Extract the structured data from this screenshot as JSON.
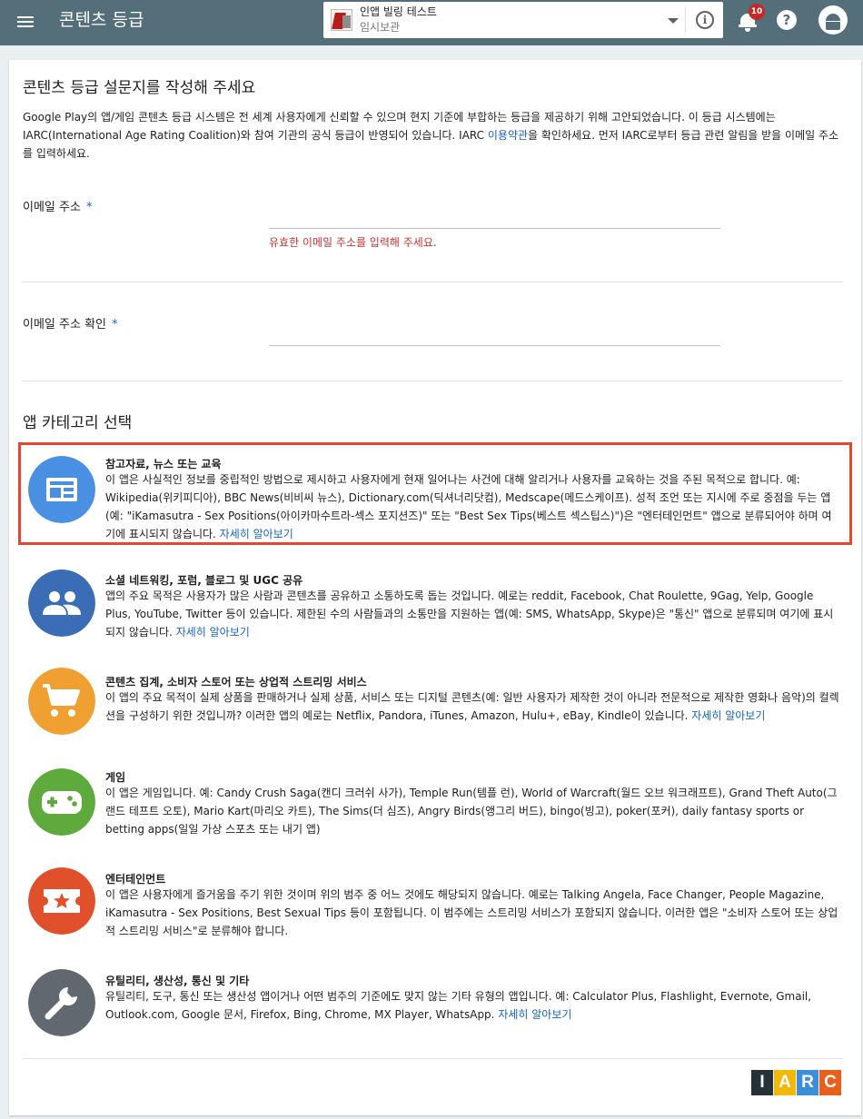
{
  "header": {
    "title": "콘텐츠 등급",
    "app": {
      "name": "인앱 빌링 테스트",
      "status": "임시보관"
    },
    "notifications_count": "10",
    "colors": {
      "bar": "#546e7a",
      "badge": "#c62828"
    }
  },
  "questionnaire": {
    "title": "콘텐츠 등급 설문지를 작성해 주세요",
    "intro_part1": "Google Play의 앱/게임 콘텐츠 등급 시스템은 전 세계 사용자에게 신뢰할 수 있으며 현지 기준에 부합하는 등급을 제공하기 위해 고안되었습니다. 이 등급 시스템에는 IARC(International Age Rating Coalition)와 참여 기관의 공식 등급이 반영되어 있습니다. IARC ",
    "intro_link": "이용약관",
    "intro_part2": "을 확인하세요. 먼저 IARC로부터 등급 관련 알림을 받을 이메일 주소를 입력하세요.",
    "email_label": "이메일 주소",
    "email_value": "",
    "email_error": "유효한 이메일 주소를 입력해 주세요.",
    "email_confirm_label": "이메일 주소 확인",
    "email_confirm_value": "",
    "required_mark": "*"
  },
  "category_section": {
    "title": "앱 카테고리 선택",
    "learn_more": "자세히 알아보기",
    "selected_border_color": "#e8442f",
    "items": [
      {
        "icon": "newspaper-icon",
        "color": "#4a90e2",
        "title": "참고자료, 뉴스 또는 교육",
        "desc": "이 앱은 사실적인 정보를 중립적인 방법으로 제시하고 사용자에게 현재 일어나는 사건에 대해 알리거나 사용자를 교육하는 것을 주된 목적으로 합니다. 예: Wikipedia(위키피디아), BBC News(비비씨 뉴스), Dictionary.com(딕셔너리닷컴), Medscape(메드스케이프). 성적 조언 또는 지시에 주로 중점을 두는 앱(예: \"iKamasutra - Sex Positions(아이카마수트라-섹스 포지션즈)\" 또는 \"Best Sex Tips(베스트 섹스팁스)\")은 \"엔터테인먼트\" 앱으로 분류되어야 하며 여기에 표시되지 않습니다. "
      },
      {
        "icon": "people-icon",
        "color": "#3a6db5",
        "title": "소셜 네트워킹, 포럼, 블로그 및 UGC 공유",
        "desc": "앱의 주요 목적은 사용자가 많은 사람과 콘텐츠를 공유하고 소통하도록 돕는 것입니다. 예로는 reddit, Facebook, Chat Roulette, 9Gag, Yelp, Google Plus, YouTube, Twitter 등이 있습니다. 제한된 수의 사람들과의 소통만을 지원하는 앱(예: SMS, WhatsApp, Skype)은 \"통신\" 앱으로 분류되며 여기에 표시되지 않습니다. "
      },
      {
        "icon": "cart-icon",
        "color": "#f0a030",
        "title": "콘텐츠 집계, 소비자 스토어 또는 상업적 스트리밍 서비스",
        "desc": "이 앱의 주요 목적이 실제 상품을 판매하거나 실제 상품, 서비스 또는 디지털 콘텐츠(예: 일반 사용자가 제작한 것이 아니라 전문적으로 제작한 영화나 음악)의 컬렉션을 구성하기 위한 것입니까? 이러한 앱의 예로는 Netflix, Pandora, iTunes, Amazon, Hulu+, eBay, Kindle이 있습니다. "
      },
      {
        "icon": "gamepad-icon",
        "color": "#5faa3c",
        "title": "게임",
        "desc": "이 앱은 게임입니다. 예: Candy Crush Saga(캔디 크러쉬 사가), Temple Run(템플 런), World of Warcraft(월드 오브 워크래프트), Grand Theft Auto(그랜드 테프트 오토), Mario Kart(마리오 카트), The Sims(더 심즈), Angry Birds(앵그리 버드), bingo(빙고), poker(포커), daily fantasy sports or betting apps(일일 가상 스포츠 또는 내기 앱)"
      },
      {
        "icon": "ticket-star-icon",
        "color": "#e0502a",
        "title": "엔터테인먼트",
        "desc": "이 앱은 사용자에게 즐거움을 주기 위한 것이며 위의 범주 중 어느 것에도 해당되지 않습니다. 예로는 Talking Angela, Face Changer, People Magazine, iKamasutra - Sex Positions, Best Sexual Tips 등이 포함됩니다. 이 범주에는 스트리밍 서비스가 포함되지 않습니다. 이러한 앱은 \"소비자 스토어 또는 상업적 스트리밍 서비스\"로 분류해야 합니다."
      },
      {
        "icon": "wrench-icon",
        "color": "#616870",
        "title": "유틸리티, 생산성, 통신 및 기타",
        "desc": "유틸리티, 도구, 통신 또는 생산성 앱이거나 어떤 범주의 기준에도 맞지 않는 기타 유형의 앱입니다. 예: Calculator Plus, Flashlight, Evernote, Gmail, Outlook.com, Google 문서, Firefox, Bing, Chrome, MX Player, WhatsApp. "
      }
    ]
  },
  "footer": {
    "logo_letters": [
      "I",
      "A",
      "R",
      "C"
    ],
    "logo_colors": [
      "#263238",
      "#f2b807",
      "#3a8fd8",
      "#e8601c"
    ]
  }
}
